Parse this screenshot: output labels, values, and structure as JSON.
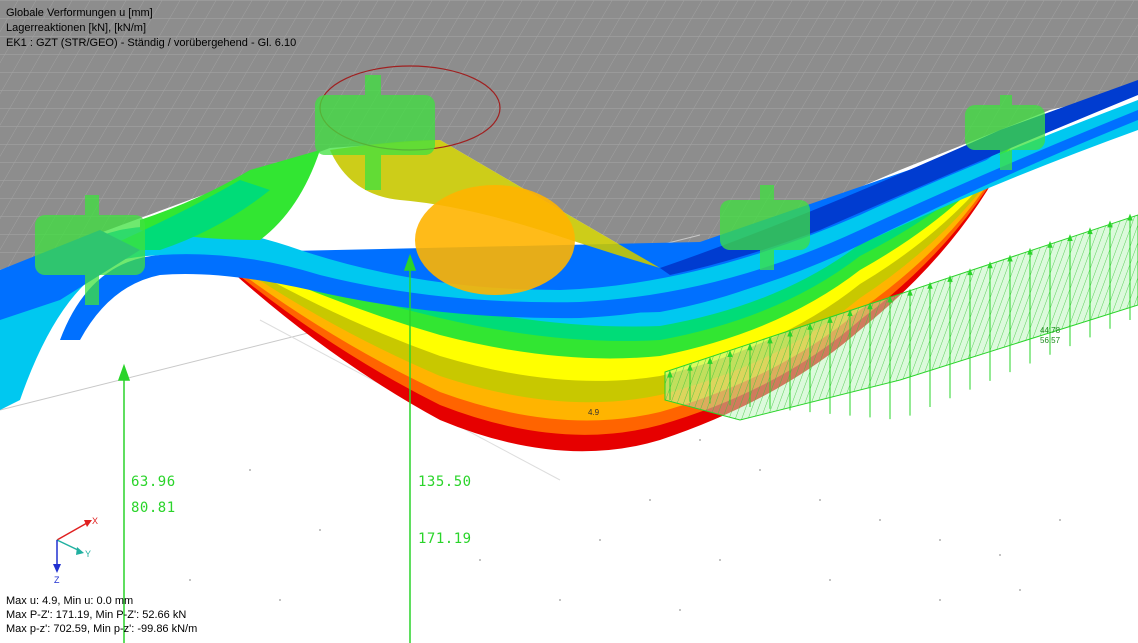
{
  "header": {
    "line1": "Globale Verformungen u [mm]",
    "line2": "Lagerreaktionen [kN], [kN/m]",
    "line3": "EK1 : GZT (STR/GEO) - Ständig / vorübergehend - Gl. 6.10"
  },
  "reactions": {
    "left_top": "63.96",
    "left_bottom": "80.81",
    "mid_top": "135.50",
    "mid_bottom": "171.19",
    "line_load_1": "44.78",
    "line_load_2": "56.57",
    "max_marker": "4.9"
  },
  "axes": {
    "x": "X",
    "y": "Y",
    "z": "Z"
  },
  "footer": {
    "line1": "Max u: 4.9, Min u: 0.0 mm",
    "line2": "Max P-Z': 171.19, Min P-Z': 52.66 kN",
    "line3": "Max p-z': 702.59, Min p-z': -99.86 kN/m"
  },
  "colors": {
    "slab_gray": "#8c8c8c",
    "reaction_green": "#2ad42a",
    "contour": [
      "#003cd0",
      "#0070ff",
      "#00c8f0",
      "#00dc78",
      "#32e632",
      "#ffff00",
      "#c8c800",
      "#ffb400",
      "#ff6400",
      "#e60000"
    ]
  }
}
